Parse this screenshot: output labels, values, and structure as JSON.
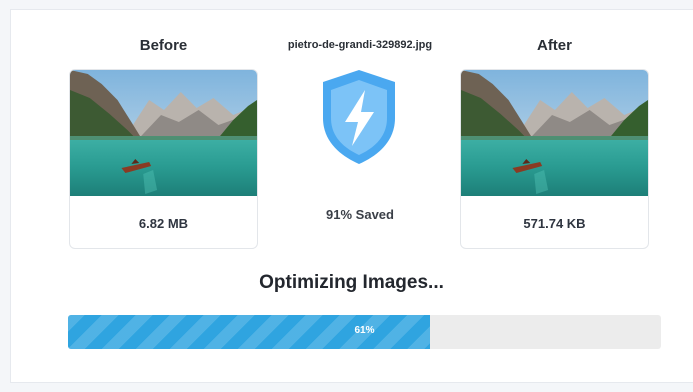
{
  "before": {
    "title": "Before",
    "size": "6.82 MB"
  },
  "after": {
    "title": "After",
    "size": "571.74 KB"
  },
  "file": {
    "name": "pietro-de-grandi-329892.jpg"
  },
  "savings": {
    "text": "91% Saved",
    "icon": "shield-lightning-icon",
    "icon_color": "#4aa8f0"
  },
  "status": {
    "text": "Optimizing Images..."
  },
  "progress": {
    "value": 61,
    "label": "61%",
    "fill_color": "#2fa4e0"
  }
}
